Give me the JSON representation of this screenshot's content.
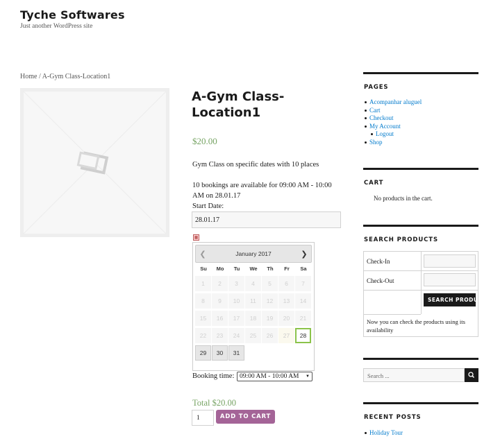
{
  "site": {
    "title": "Tyche Softwares",
    "description": "Just another WordPress site"
  },
  "breadcrumb": {
    "home": "Home",
    "separator": " / ",
    "current": "A-Gym Class-Location1"
  },
  "product": {
    "title": "A-Gym Class-Location1",
    "price": "$20.00",
    "description": "Gym Class on specific dates with 10 places",
    "availability": "10 bookings are available for 09:00 AM - 10:00 AM on 28.01.17",
    "start_date_label": "Start Date:",
    "start_date_value": "28.01.17",
    "booking_time_label": "Booking time:",
    "booking_time_value": "09:00 AM - 10:00 AM",
    "total": "Total $20.00",
    "quantity": "1",
    "add_to_cart_label": "ADD TO CART"
  },
  "datepicker": {
    "month_title": "January 2017",
    "weekdays": [
      "Su",
      "Mo",
      "Tu",
      "We",
      "Th",
      "Fr",
      "Sa"
    ],
    "weeks": [
      [
        {
          "d": "1",
          "s": "off"
        },
        {
          "d": "2",
          "s": "off"
        },
        {
          "d": "3",
          "s": "off"
        },
        {
          "d": "4",
          "s": "off"
        },
        {
          "d": "5",
          "s": "off"
        },
        {
          "d": "6",
          "s": "off"
        },
        {
          "d": "7",
          "s": "off"
        }
      ],
      [
        {
          "d": "8",
          "s": "off"
        },
        {
          "d": "9",
          "s": "off"
        },
        {
          "d": "10",
          "s": "off"
        },
        {
          "d": "11",
          "s": "off"
        },
        {
          "d": "12",
          "s": "off"
        },
        {
          "d": "13",
          "s": "off"
        },
        {
          "d": "14",
          "s": "off"
        }
      ],
      [
        {
          "d": "15",
          "s": "off"
        },
        {
          "d": "16",
          "s": "off"
        },
        {
          "d": "17",
          "s": "off"
        },
        {
          "d": "18",
          "s": "off"
        },
        {
          "d": "19",
          "s": "off"
        },
        {
          "d": "20",
          "s": "off"
        },
        {
          "d": "21",
          "s": "off"
        }
      ],
      [
        {
          "d": "22",
          "s": "off"
        },
        {
          "d": "23",
          "s": "off"
        },
        {
          "d": "24",
          "s": "off"
        },
        {
          "d": "25",
          "s": "off"
        },
        {
          "d": "26",
          "s": "off"
        },
        {
          "d": "27",
          "s": "hl"
        },
        {
          "d": "28",
          "s": "sel"
        }
      ],
      [
        {
          "d": "29",
          "s": "on"
        },
        {
          "d": "30",
          "s": "on"
        },
        {
          "d": "31",
          "s": "on"
        },
        {
          "d": "",
          "s": "empty"
        },
        {
          "d": "",
          "s": "empty"
        },
        {
          "d": "",
          "s": "empty"
        },
        {
          "d": "",
          "s": "empty"
        }
      ]
    ],
    "prev_icon": "chevron-left-icon",
    "next_icon": "chevron-right-icon"
  },
  "sidebar": {
    "pages": {
      "title": "PAGES",
      "items": [
        {
          "label": "Acompanhar aluguel",
          "sub": false
        },
        {
          "label": "Cart",
          "sub": false
        },
        {
          "label": "Checkout",
          "sub": false
        },
        {
          "label": "My Account",
          "sub": false
        },
        {
          "label": "Logout",
          "sub": true
        },
        {
          "label": "Shop",
          "sub": false
        }
      ]
    },
    "cart": {
      "title": "CART",
      "empty_text": "No products in the cart."
    },
    "search_products": {
      "title": "SEARCH PRODUCTS",
      "check_in_label": "Check-In",
      "check_out_label": "Check-Out",
      "button_label": "SEARCH PRODUCTS",
      "note": "Now you can check the products using its availability"
    },
    "search": {
      "placeholder": "Search ...",
      "icon": "search-icon"
    },
    "recent_posts": {
      "title": "RECENT POSTS",
      "items": [
        "Holiday Tour"
      ]
    }
  },
  "colors": {
    "price": "#77a464",
    "button": "#a46497",
    "link": "#007acc",
    "selected_day_border": "#8bc34a"
  }
}
